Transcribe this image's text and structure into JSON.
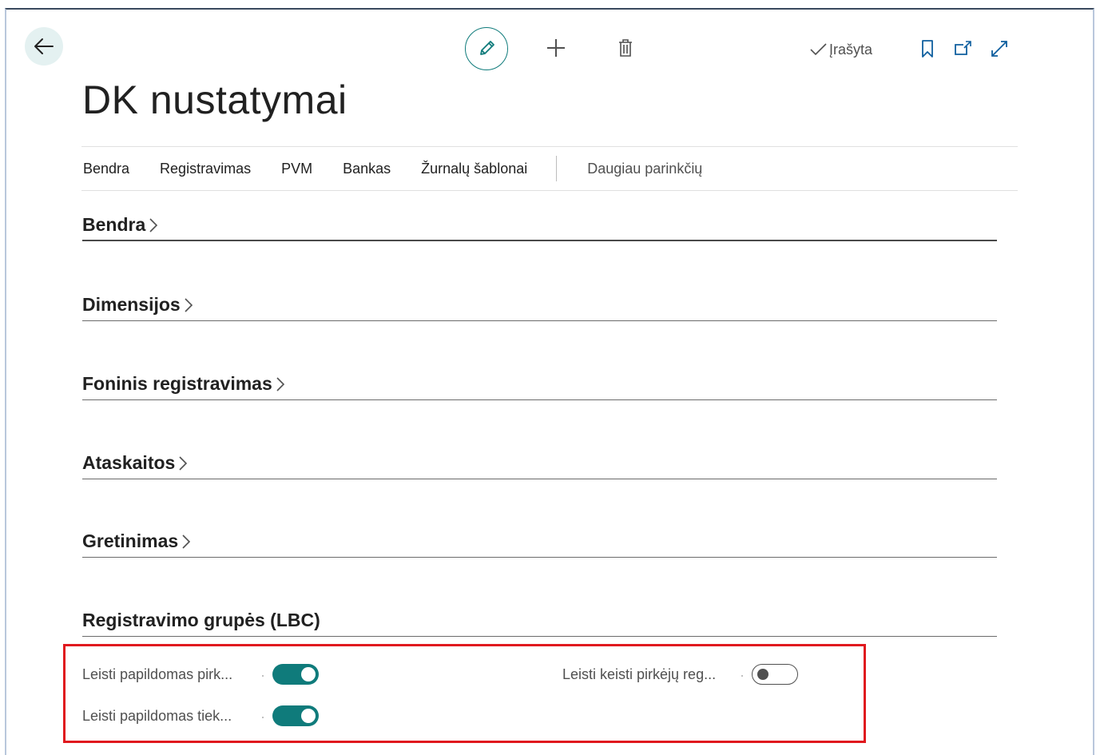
{
  "header": {
    "title": "DK nustatymai",
    "saved_status": "Įrašyta"
  },
  "icons": {
    "back": "arrow-left-icon",
    "edit": "pencil-icon",
    "new": "plus-icon",
    "delete": "trash-icon",
    "saved": "checkmark-icon",
    "bookmark": "bookmark-icon",
    "popout": "popout-icon",
    "expand": "expand-icon"
  },
  "tabs": [
    {
      "label": "Bendra"
    },
    {
      "label": "Registravimas"
    },
    {
      "label": "PVM"
    },
    {
      "label": "Bankas"
    },
    {
      "label": "Žurnalų šablonai"
    }
  ],
  "more_options": "Daugiau parinkčių",
  "sections": [
    {
      "title": "Bendra",
      "collapsed": true
    },
    {
      "title": "Dimensijos",
      "collapsed": true
    },
    {
      "title": "Foninis registravimas",
      "collapsed": true
    },
    {
      "title": "Ataskaitos",
      "collapsed": true
    },
    {
      "title": "Gretinimas",
      "collapsed": true
    },
    {
      "title": "Registravimo grupės (LBC)",
      "collapsed": false
    }
  ],
  "fields": [
    {
      "label": "Leisti papildomas pirk...",
      "value": true
    },
    {
      "label": "Leisti papildomas tiek...",
      "value": true
    },
    {
      "label": "Leisti keisti pirkėjų reg...",
      "value": false
    }
  ],
  "colors": {
    "accent": "#0f7b7b",
    "highlight": "#e0191e",
    "back_bg": "#e4f1f1"
  }
}
